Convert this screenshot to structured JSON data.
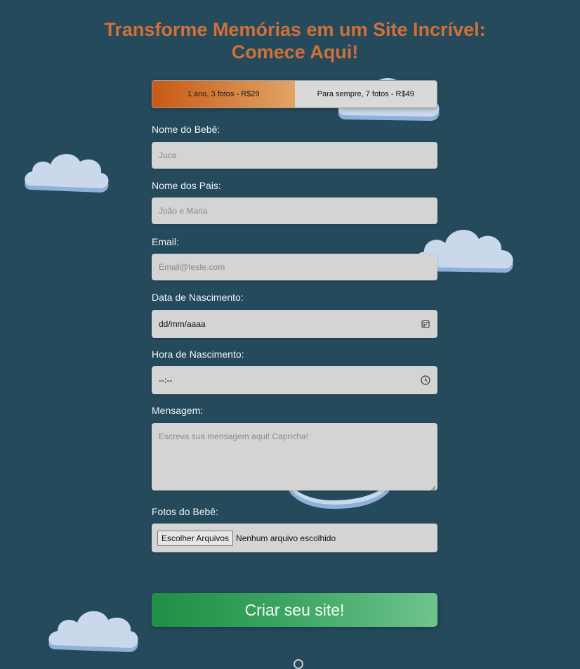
{
  "header": {
    "title_line1": "Transforme Memórias em um Site Incrível:",
    "title_line2": "Comece Aqui!"
  },
  "plans": [
    {
      "label": "1 ano, 3 fotos - R$29",
      "selected": true
    },
    {
      "label": "Para sempre, 7 fotos - R$49",
      "selected": false
    }
  ],
  "form": {
    "baby_name_label": "Nome do Bebê:",
    "baby_name_placeholder": "Juca",
    "parents_label": "Nome dos Pais:",
    "parents_placeholder": "João e Maria",
    "email_label": "Email:",
    "email_placeholder": "Email@teste.com",
    "birth_date_label": "Data de Nascimento:",
    "birth_date_value": "dd/mm/aaaa",
    "birth_time_label": "Hora de Nascimento:",
    "birth_time_value": "--:--",
    "message_label": "Mensagem:",
    "message_placeholder": "Escreva sua mensagem aqui! Capricha!",
    "photos_label": "Fotos do Bebê:",
    "photos_button": "Escolher Arquivos",
    "photos_status": "Nenhum arquivo escolhido",
    "submit_label": "Criar seu site!"
  },
  "icons": {
    "date": "calendar-icon",
    "time": "clock-icon"
  },
  "colors": {
    "background": "#244a5b",
    "title": "#d2703a",
    "plan_active_start": "#c85a16",
    "plan_active_end": "#e2a464",
    "submit_start": "#1e8f45",
    "submit_end": "#6ec48d",
    "cloud": "#c9d8ea",
    "cloud_shadow": "#8fb0d8"
  }
}
